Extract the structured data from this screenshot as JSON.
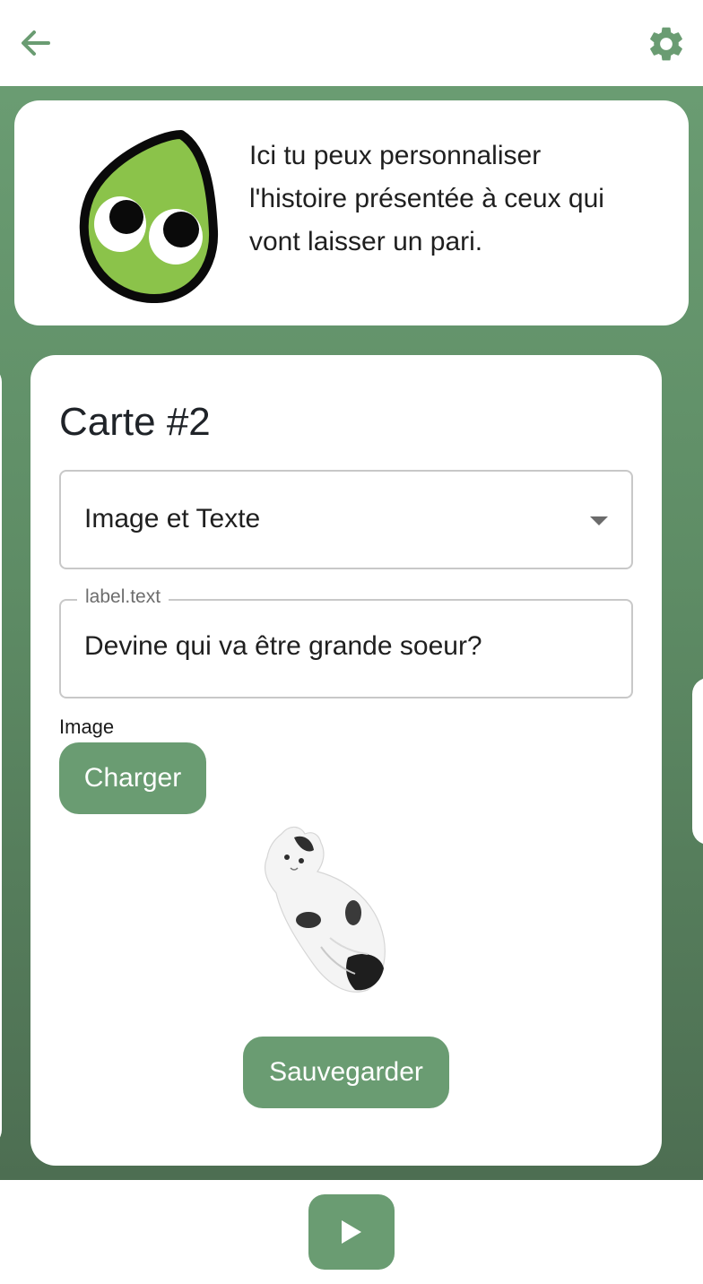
{
  "header": {
    "back_icon": "arrow-left-icon",
    "settings_icon": "gear-icon"
  },
  "intro": {
    "text": "Ici tu peux personnaliser l'histoire présentée à ceux qui vont laisser un pari.",
    "mascot_icon": "green-drop-mascot"
  },
  "card": {
    "title": "Carte #2",
    "type_select": {
      "value": "Image et Texte"
    },
    "text_field": {
      "label": "label.text",
      "value": "Devine qui va être grande soeur?"
    },
    "image_label": "Image",
    "upload_label": "Charger",
    "save_label": "Sauvegarder"
  },
  "footer": {
    "play_icon": "play-icon"
  },
  "colors": {
    "accent": "#6a9c72",
    "background_top": "#6a9c72",
    "background_bottom": "#4d6e52",
    "card": "#ffffff"
  }
}
